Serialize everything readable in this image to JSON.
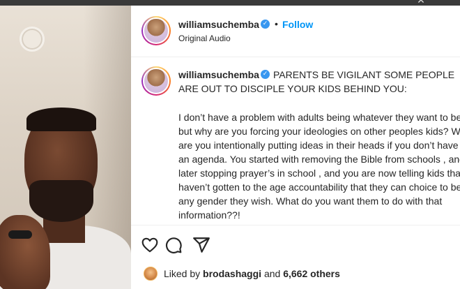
{
  "window": {
    "close_icon": "close-icon"
  },
  "post": {
    "header": {
      "username": "williamsuchemba",
      "separator": "•",
      "follow_label": "Follow",
      "audio_label": "Original Audio"
    },
    "caption": {
      "username": "williamsuchemba",
      "title": "PARENTS BE VIGILANT SOME PEOPLE ARE OUT TO DISCIPLE YOUR KIDS BEHIND YOU:",
      "body": "I don’t have a problem with adults being whatever they want to be but why are you forcing your ideologies on other peoples kids? Why are you intentionally putting ideas in their heads if you don’t have an agenda. You started with removing the Bible from schools , and later stopping prayer’s in school , and you are now telling kids that haven’t gotten to the age accountability that they can choice to be any gender they wish. What do you want them to do with that information??!"
    },
    "actions": {
      "like_icon": "heart-icon",
      "comment_icon": "comment-icon",
      "share_icon": "share-icon"
    },
    "likes": {
      "prefix": "Liked by",
      "liker": "brodashaggi",
      "joiner": "and",
      "others": "6,662 others"
    }
  },
  "colors": {
    "follow_blue": "#0095f6",
    "verified_blue": "#3897f0",
    "text": "#262626"
  }
}
